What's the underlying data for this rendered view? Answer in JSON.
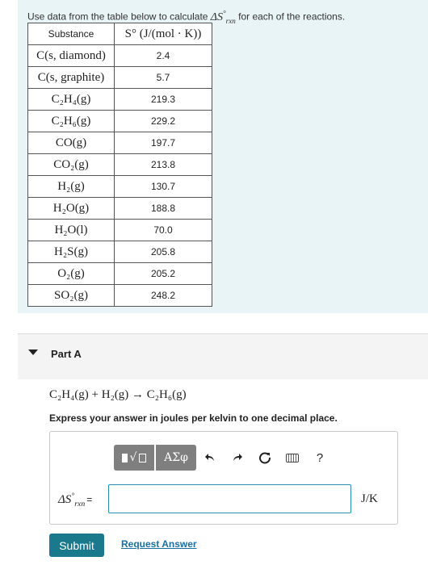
{
  "intro": {
    "text_before": "Use data from the table below to calculate ",
    "delta_s": "ΔS",
    "sup": "°",
    "sub": "rxn",
    "text_after": " for each of the reactions."
  },
  "table": {
    "headers": [
      "Substance",
      "S° (J/(mol · K))"
    ],
    "rows": [
      {
        "substance": "C(s, diamond)",
        "value": "2.4"
      },
      {
        "substance": "C(s, graphite)",
        "value": "5.7"
      },
      {
        "substance": "C₂H₄(g)",
        "value": "219.3"
      },
      {
        "substance": "C₂H₆(g)",
        "value": "229.2"
      },
      {
        "substance": "CO(g)",
        "value": "197.7"
      },
      {
        "substance": "CO₂(g)",
        "value": "213.8"
      },
      {
        "substance": "H₂(g)",
        "value": "130.7"
      },
      {
        "substance": "H₂O(g)",
        "value": "188.8"
      },
      {
        "substance": "H₂O(l)",
        "value": "70.0"
      },
      {
        "substance": "H₂S(g)",
        "value": "205.8"
      },
      {
        "substance": "O₂(g)",
        "value": "205.2"
      },
      {
        "substance": "SO₂(g)",
        "value": "248.2"
      }
    ]
  },
  "part": {
    "title": "Part A",
    "expanded": true
  },
  "reaction": "C₂H₄(g) + H₂(g) → C₂H₆(g)",
  "instruction": "Express your answer in joules per kelvin to one decimal place.",
  "toolbar": {
    "greek_label": "ΑΣφ",
    "help_label": "?",
    "icons": [
      "templates-icon",
      "greek-symbols-icon",
      "undo-icon",
      "redo-icon",
      "reset-icon",
      "keyboard-icon",
      "help-icon"
    ]
  },
  "answer": {
    "label_main": "ΔS",
    "label_sup": "°",
    "label_sub": "rxn",
    "label_eq": "=",
    "value": "",
    "unit": "J/K"
  },
  "buttons": {
    "submit": "Submit",
    "request_answer": "Request Answer"
  },
  "colors": {
    "intro_bg": "#e8f4f6",
    "submit_bg": "#1a7a8c",
    "link": "#1a6fa0",
    "input_border": "#2a8fb3"
  }
}
